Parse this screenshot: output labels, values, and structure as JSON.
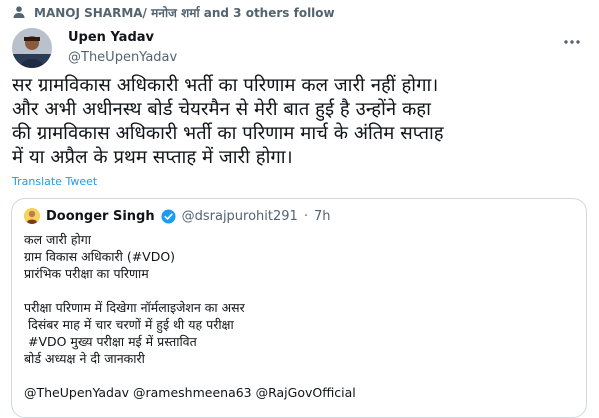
{
  "social_context": {
    "text": "MANOJ SHARMA/ मनोज शर्मा and 3 others follow"
  },
  "tweet": {
    "display_name": "Upen Yadav",
    "handle": "@TheUpenYadav",
    "text": "सर ग्रामविकास अधिकारी भर्ती का परिणाम कल जारी नहीं होगा।\nऔर अभी अधीनस्थ बोर्ड चेयरमैन से मेरी बात हुई है उन्होंने कहा\nकी ग्रामविकास अधिकारी भर्ती का परिणाम मार्च के अंतिम सप्ताह\nमें या अप्रैल के प्रथम सप्ताह में जारी होगा।",
    "translate_label": "Translate Tweet"
  },
  "quote": {
    "name": "Doonger Singh",
    "handle": "@dsrajpurohit291",
    "separator": "·",
    "time": "7h",
    "lines": [
      "कल जारी होगा",
      "ग्राम विकास अधिकारी (#VDO)",
      "प्रारंभिक परीक्षा का परिणाम",
      "",
      "परीक्षा परिणाम में दिखेगा नॉर्मलाइजेशन का असर",
      " दिसंबर माह में चार चरणों में हुई थी यह परीक्षा",
      " #VDO मुख्य परीक्षा मई में प्रस्तावित",
      "बोर्ड अध्यक्ष ने दी जानकारी",
      ""
    ],
    "mentions": "@TheUpenYadav @rameshmeena63 @RajGovOfficial"
  },
  "icons": {
    "social_context": "person-icon",
    "more": "more-options-icon",
    "verified": "verified-badge-icon"
  },
  "colors": {
    "accent": "#1d9bf0",
    "secondary_text": "#536471",
    "border": "#cfd9de"
  }
}
